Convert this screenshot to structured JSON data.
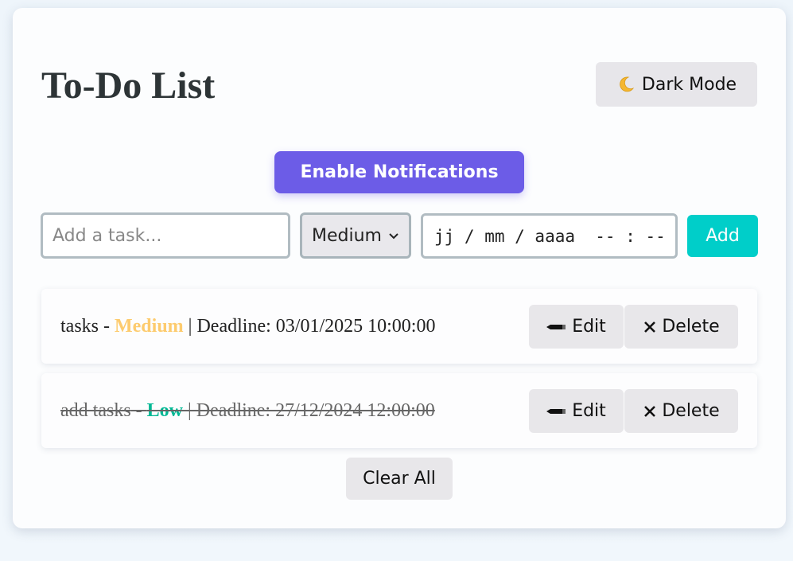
{
  "header": {
    "title": "To-Do List",
    "dark_mode_label": "Dark Mode",
    "dark_mode_icon": "moon-icon"
  },
  "notifications": {
    "button_label": "Enable Notifications",
    "color": "#6c5ce7"
  },
  "form": {
    "task_input": {
      "value": "",
      "placeholder": "Add a task..."
    },
    "priority_select": {
      "selected": "Medium"
    },
    "deadline_input": {
      "placeholder": "jj / mm / aaaa  -- : --"
    },
    "add_label": "Add",
    "add_color": "#00cec9"
  },
  "tasks": [
    {
      "name": "tasks",
      "separator": " - ",
      "priority": "Medium",
      "priority_color": "#fdcb6e",
      "deadline_text": " | Deadline: 03/01/2025 10:00:00",
      "completed": false,
      "edit_label": "Edit",
      "delete_label": "Delete"
    },
    {
      "name": "add tasks",
      "separator": " - ",
      "priority": "Low",
      "priority_color": "#00b894",
      "deadline_text": " | Deadline: 27/12/2024 12:00:00",
      "completed": true,
      "edit_label": "Edit",
      "delete_label": "Delete"
    }
  ],
  "footer": {
    "clear_all_label": "Clear All"
  }
}
